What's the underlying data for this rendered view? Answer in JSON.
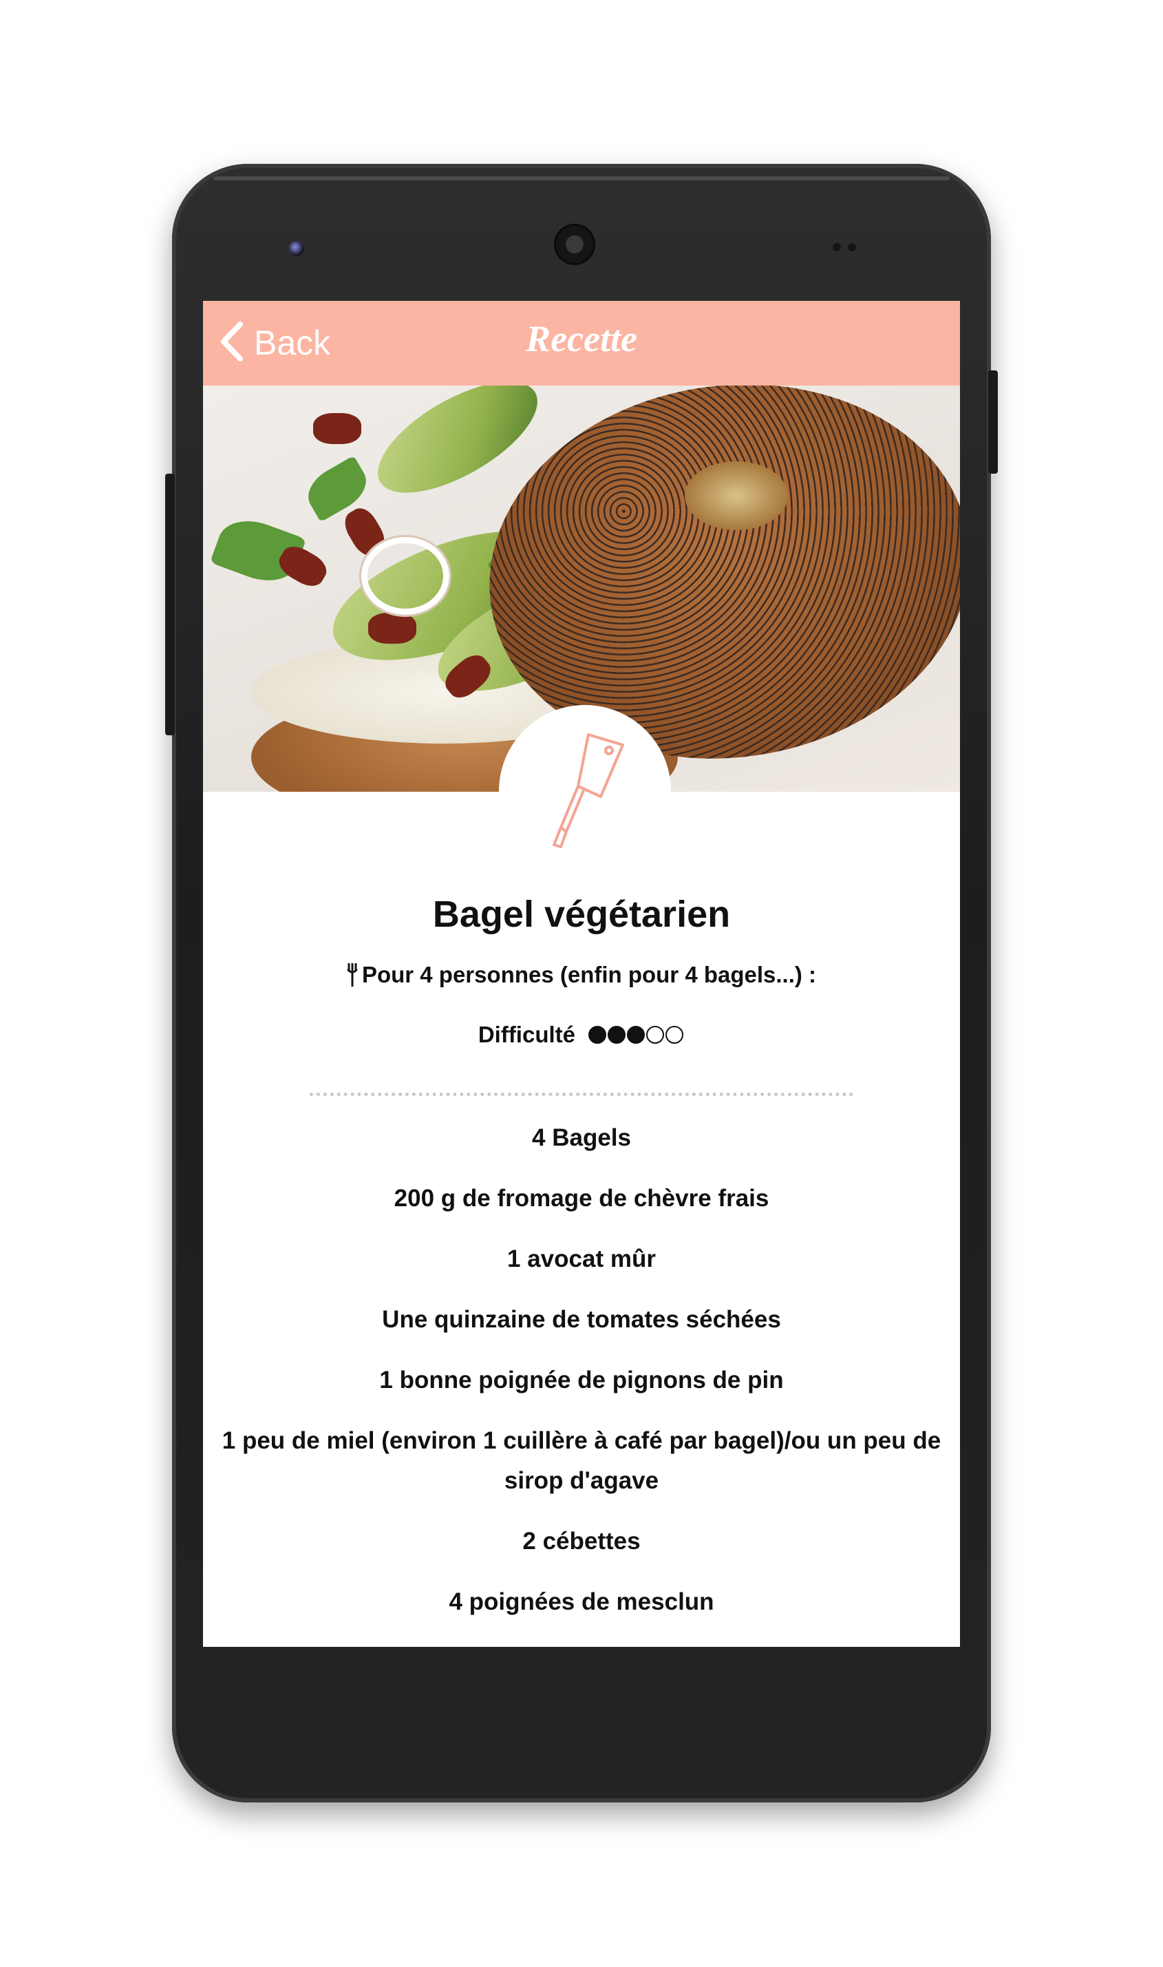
{
  "header": {
    "back_label": "Back",
    "title": "Recette"
  },
  "recipe": {
    "title": "Bagel végétarien",
    "servings": "Pour 4 personnes (enfin pour 4 bagels...) :",
    "difficulty_label": "Difficulté",
    "difficulty_level": 3,
    "difficulty_max": 5,
    "ingredients": [
      "4 Bagels",
      "200 g de fromage de chèvre frais",
      "1 avocat mûr",
      "Une quinzaine de tomates séchées",
      "1 bonne poignée de pignons de pin",
      "1 peu de miel (environ 1 cuillère à café par bagel)/ou un peu de sirop d'agave",
      "2 cébettes",
      "4 poignées de mesclun"
    ]
  },
  "colors": {
    "header_bg": "#fbb5a2",
    "accent": "#f3a493",
    "text": "#111111"
  },
  "icons": {
    "back": "chevron-left-icon",
    "emblem": "cleaver-knife-icon",
    "servings": "fork-icon"
  }
}
